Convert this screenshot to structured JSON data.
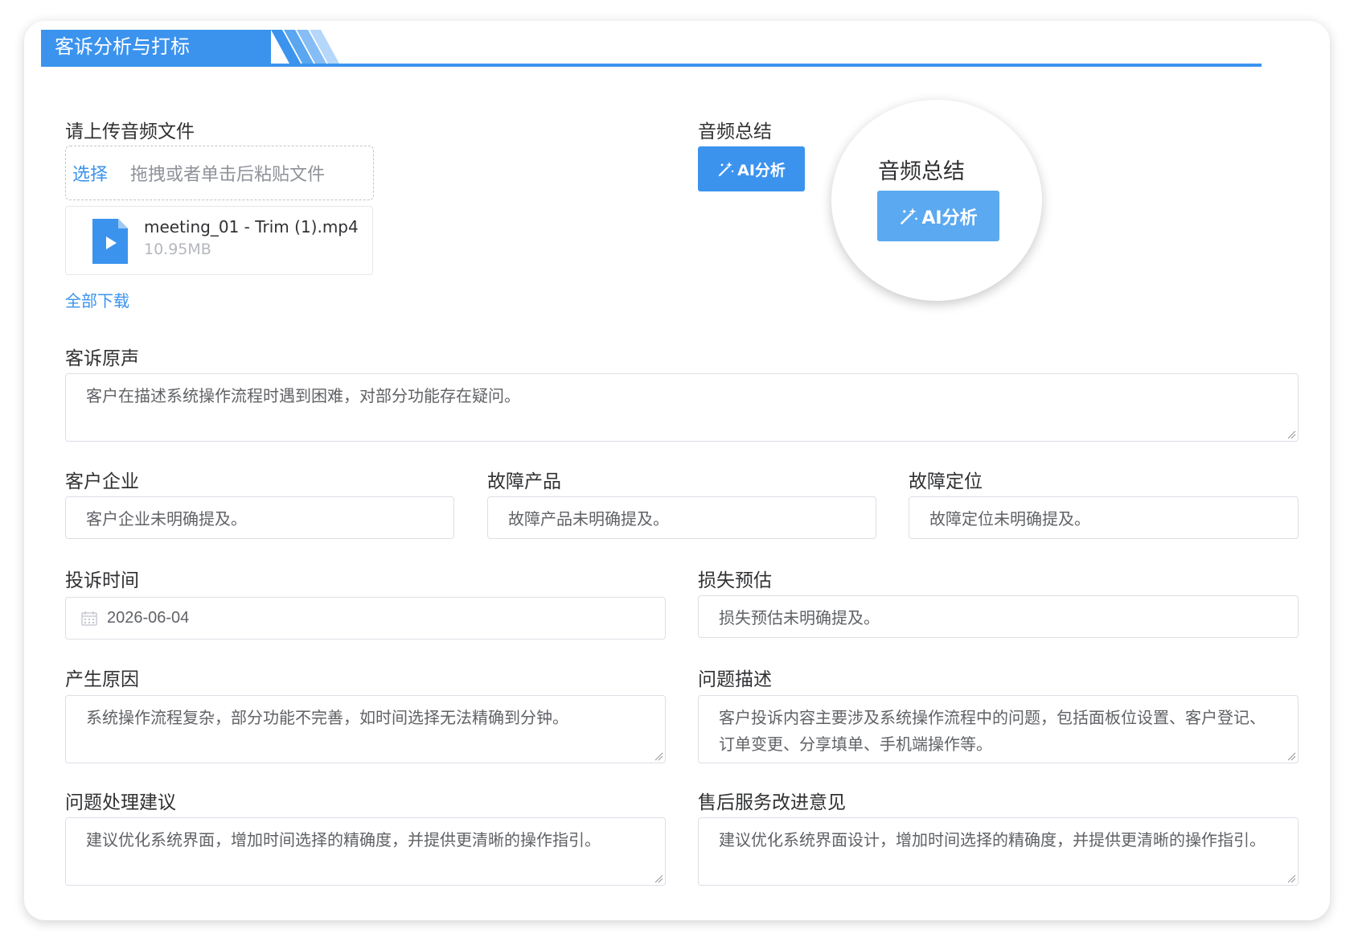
{
  "header": {
    "title": "客诉分析与打标"
  },
  "upload": {
    "label": "请上传音频文件",
    "select_label": "选择",
    "hint": "拖拽或者单击后粘贴文件",
    "file": {
      "name": "meeting_01 - Trim (1).mp4",
      "size": "10.95MB"
    },
    "download_all": "全部下载"
  },
  "summary": {
    "label": "音频总结",
    "ai_button": "AI分析",
    "zoom_label": "音频总结",
    "zoom_button": "AI分析"
  },
  "fields": {
    "complaint_voice": {
      "label": "客诉原声",
      "value": "客户在描述系统操作流程时遇到困难，对部分功能存在疑问。"
    },
    "customer_company": {
      "label": "客户企业",
      "value": "客户企业未明确提及。"
    },
    "fault_product": {
      "label": "故障产品",
      "value": "故障产品未明确提及。"
    },
    "fault_location": {
      "label": "故障定位",
      "value": "故障定位未明确提及。"
    },
    "complaint_time": {
      "label": "投诉时间",
      "value": "2026-06-04"
    },
    "loss_estimate": {
      "label": "损失预估",
      "value": "损失预估未明确提及。"
    },
    "cause": {
      "label": "产生原因",
      "value": "系统操作流程复杂，部分功能不完善，如时间选择无法精确到分钟。"
    },
    "description": {
      "label": "问题描述",
      "value": "客户投诉内容主要涉及系统操作流程中的问题，包括面板位设置、客户登记、订单变更、分享填单、手机端操作等。"
    },
    "handling": {
      "label": "问题处理建议",
      "value": "建议优化系统界面，增加时间选择的精确度，并提供更清晰的操作指引。"
    },
    "improvement": {
      "label": "售后服务改进意见",
      "value": "建议优化系统界面设计，增加时间选择的精确度，并提供更清晰的操作指引。"
    }
  },
  "colors": {
    "primary": "#3b93ee",
    "border": "#dcdfe6",
    "text": "#303133",
    "value_text": "#606266"
  }
}
